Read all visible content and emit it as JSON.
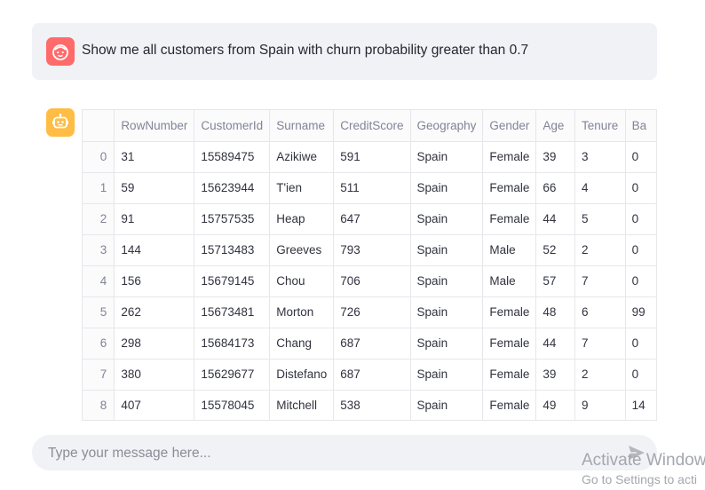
{
  "user_message": {
    "text": "Show me all customers from Spain with churn probability greater than 0.7"
  },
  "table": {
    "columns": [
      "",
      "RowNumber",
      "CustomerId",
      "Surname",
      "CreditScore",
      "Geography",
      "Gender",
      "Age",
      "Tenure",
      "Ba"
    ],
    "rows": [
      [
        "0",
        "31",
        "15589475",
        "Azikiwe",
        "591",
        "Spain",
        "Female",
        "39",
        "3",
        "0"
      ],
      [
        "1",
        "59",
        "15623944",
        "T'ien",
        "511",
        "Spain",
        "Female",
        "66",
        "4",
        "0"
      ],
      [
        "2",
        "91",
        "15757535",
        "Heap",
        "647",
        "Spain",
        "Female",
        "44",
        "5",
        "0"
      ],
      [
        "3",
        "144",
        "15713483",
        "Greeves",
        "793",
        "Spain",
        "Male",
        "52",
        "2",
        "0"
      ],
      [
        "4",
        "156",
        "15679145",
        "Chou",
        "706",
        "Spain",
        "Male",
        "57",
        "7",
        "0"
      ],
      [
        "5",
        "262",
        "15673481",
        "Morton",
        "726",
        "Spain",
        "Female",
        "48",
        "6",
        "99"
      ],
      [
        "6",
        "298",
        "15684173",
        "Chang",
        "687",
        "Spain",
        "Female",
        "44",
        "7",
        "0"
      ],
      [
        "7",
        "380",
        "15629677",
        "Distefano",
        "687",
        "Spain",
        "Female",
        "39",
        "2",
        "0"
      ],
      [
        "8",
        "407",
        "15578045",
        "Mitchell",
        "538",
        "Spain",
        "Female",
        "49",
        "9",
        "14"
      ]
    ]
  },
  "chat_input": {
    "placeholder": "Type your message here..."
  },
  "watermark": {
    "line1": "Activate Window",
    "line2": "Go to Settings to acti"
  },
  "colors": {
    "user_avatar": "#ff6b6b",
    "bot_avatar": "#ffbd45",
    "message_bg": "#f0f2f6"
  },
  "icons": {
    "user": "user-face-icon",
    "bot": "robot-icon",
    "send": "send-icon"
  }
}
